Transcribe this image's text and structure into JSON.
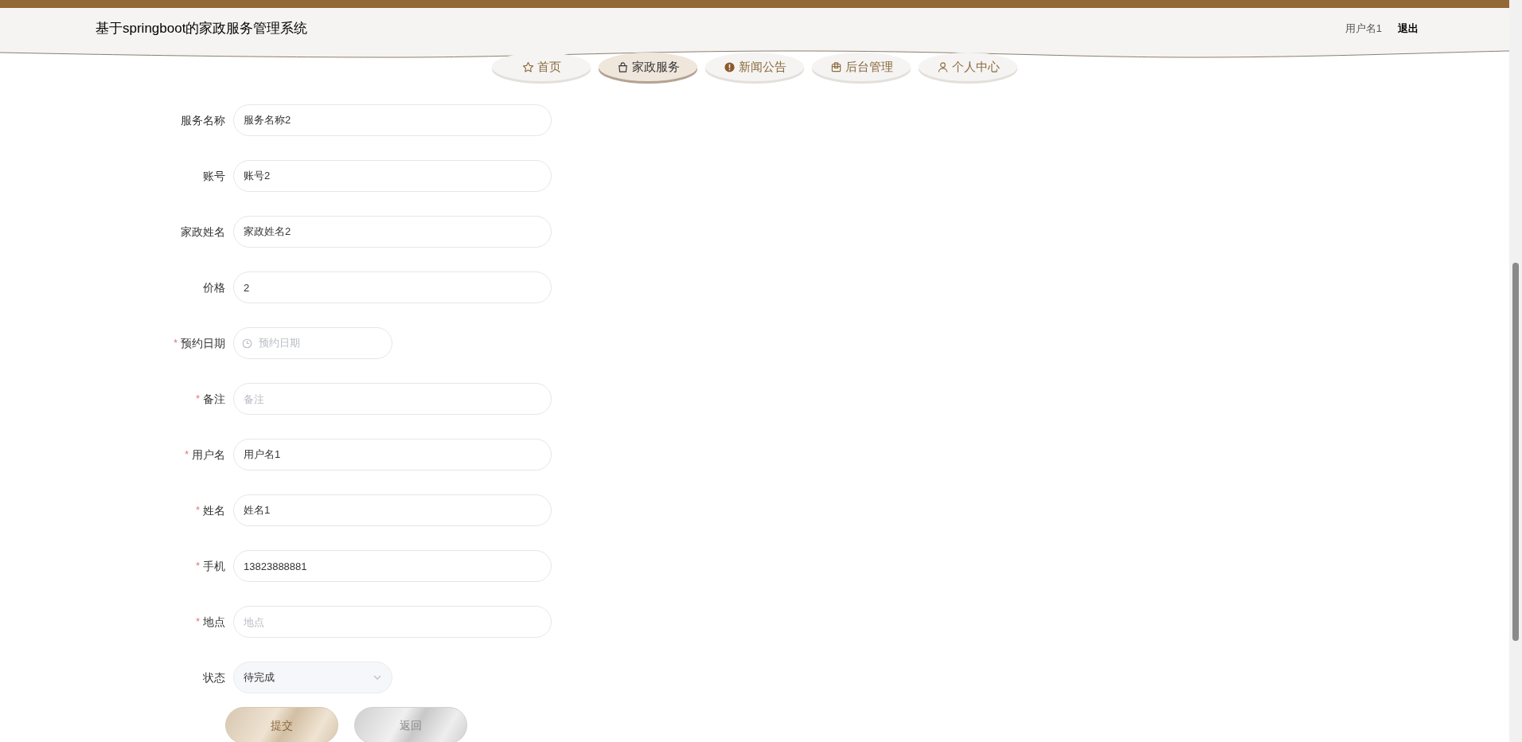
{
  "header": {
    "title": "基于springboot的家政服务管理系统",
    "username": "用户名1",
    "logout": "退出"
  },
  "nav": [
    {
      "label": "首页",
      "selected": false
    },
    {
      "label": "家政服务",
      "selected": true
    },
    {
      "label": "新闻公告",
      "selected": false
    },
    {
      "label": "后台管理",
      "selected": false
    },
    {
      "label": "个人中心",
      "selected": false
    }
  ],
  "form": [
    {
      "label": "服务名称",
      "kind": "input",
      "value": "服务名称2"
    },
    {
      "label": "账号",
      "kind": "input",
      "value": "账号2"
    },
    {
      "label": "家政姓名",
      "kind": "input",
      "value": "家政姓名2"
    },
    {
      "label": "价格",
      "kind": "input",
      "value": "2"
    },
    {
      "label": "预约日期",
      "required_mark": "*",
      "kind": "date",
      "placeholder": "预约日期"
    },
    {
      "label": "备注",
      "required_mark": "*",
      "kind": "input",
      "placeholder": "备注"
    },
    {
      "label": "用户名",
      "required_mark": "*",
      "kind": "input",
      "value": "用户名1"
    },
    {
      "label": "姓名",
      "required_mark": "*",
      "kind": "input",
      "value": "姓名1"
    },
    {
      "label": "手机",
      "required_mark": "*",
      "kind": "input",
      "value": "13823888881"
    },
    {
      "label": "地点",
      "required_mark": "*",
      "kind": "input",
      "placeholder": "地点"
    },
    {
      "label": "状态",
      "kind": "select",
      "value": "待完成"
    }
  ],
  "buttons": [
    {
      "label": "提交",
      "kind": "primary"
    },
    {
      "label": "返回",
      "kind": "secondary"
    }
  ]
}
